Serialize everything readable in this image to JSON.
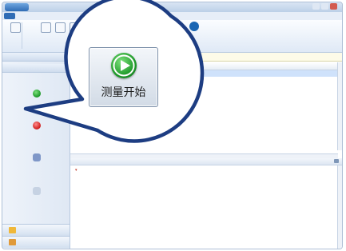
{
  "colors": {
    "accent": "#1a66b3",
    "start_green": "#1f9a2a",
    "stop_red": "#d02020",
    "selection": "#cfe2fb"
  },
  "magnifier": {
    "start_button_label": "测量开始",
    "icon": "play-icon"
  },
  "icons": {
    "start": "play-icon",
    "stop": "stop-icon",
    "window_minimize": "minimize-icon",
    "window_maximize": "maximize-icon",
    "window_close": "close-icon"
  }
}
